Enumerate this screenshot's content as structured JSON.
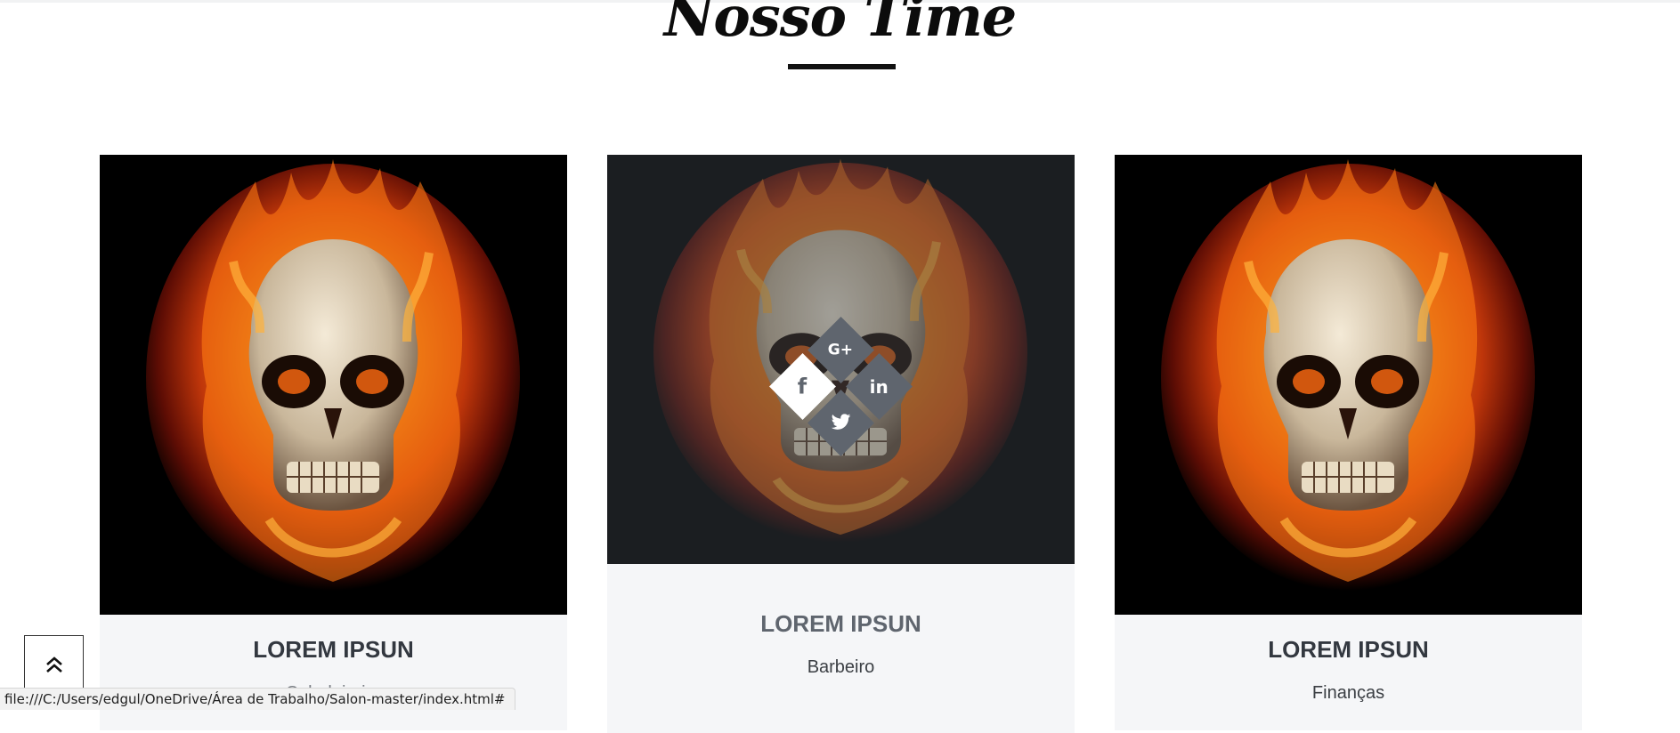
{
  "section": {
    "title": "Nosso Time"
  },
  "team": [
    {
      "name": "LOREM IPSUN",
      "role": "Cabeleireiro"
    },
    {
      "name": "LOREM IPSUN",
      "role": "Barbeiro",
      "socials": [
        "google-plus",
        "facebook",
        "linkedin",
        "twitter"
      ]
    },
    {
      "name": "LOREM IPSUN",
      "role": "Finanças"
    }
  ],
  "icons": {
    "google_plus": "G+",
    "facebook": "f",
    "linkedin": "in",
    "back_to_top": "double-chevron-up-icon"
  },
  "status_bar": {
    "url": "file:///C:/Users/edgul/OneDrive/Área de Trabalho/Salon-master/index.html#"
  },
  "colors": {
    "overlay_diamond": "#5f656e",
    "card_info_bg": "#f5f6f8",
    "title": "#0c0c0c"
  }
}
